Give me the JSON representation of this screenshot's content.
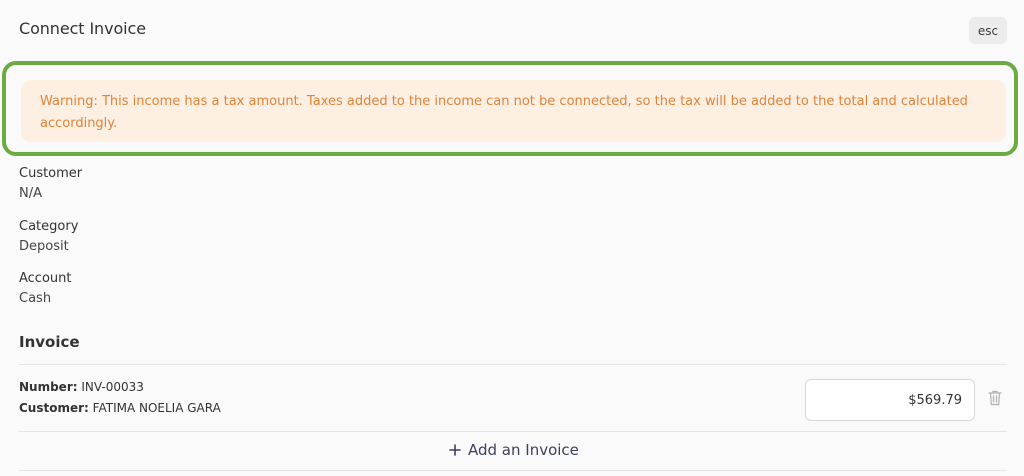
{
  "dialog": {
    "title": "Connect Invoice",
    "esc_label": "esc"
  },
  "warning": {
    "text": "Warning: This income has a tax amount. Taxes added to the income can not be connected, so the tax will be added to the total and calculated accordingly."
  },
  "details": {
    "customer_label": "Customer",
    "customer_value": "N/A",
    "category_label": "Category",
    "category_value": "Deposit",
    "account_label": "Account",
    "account_value": "Cash"
  },
  "invoice_section": {
    "title": "Invoice",
    "items": [
      {
        "number_label": "Number:",
        "number_value": "INV-00033",
        "customer_label": "Customer:",
        "customer_value": "FATIMA NOELIA GARA",
        "amount": "$569.79"
      }
    ],
    "add_label": "Add an Invoice"
  },
  "colors": {
    "highlight_border": "#6cab42",
    "warning_bg": "#fdefe2",
    "warning_text": "#e0843a"
  },
  "icons": [
    "trash-icon",
    "plus-icon"
  ]
}
